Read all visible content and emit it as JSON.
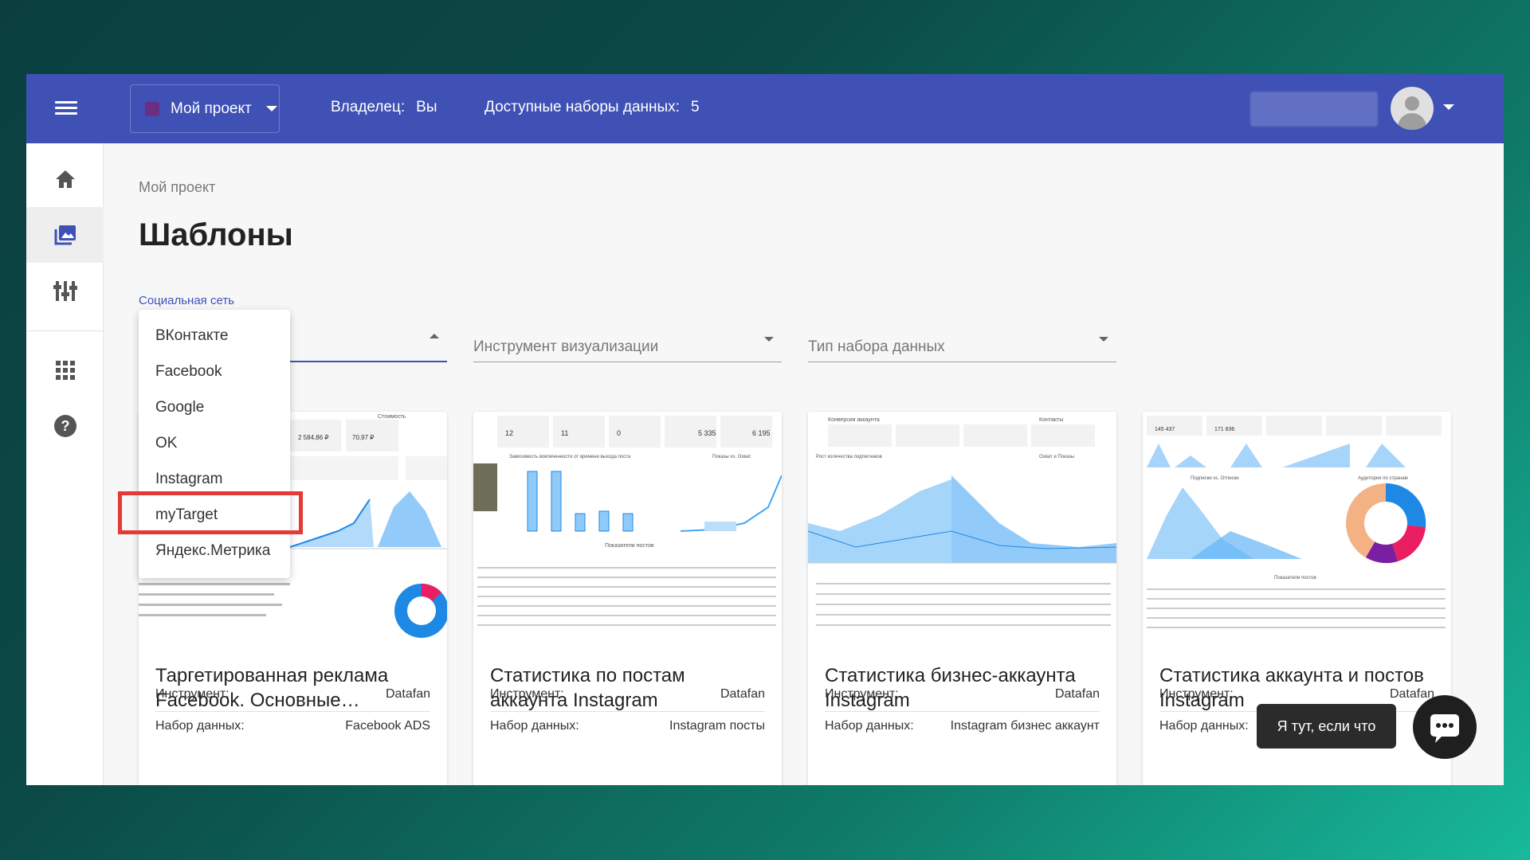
{
  "header": {
    "project_name": "Мой проект",
    "owner_label": "Владелец:",
    "owner_value": "Вы",
    "datasets_label": "Доступные наборы данных:",
    "datasets_count": "5"
  },
  "breadcrumb": "Мой проект",
  "page_title": "Шаблоны",
  "filters": {
    "social_label": "Социальная сеть",
    "viz_placeholder": "Инструмент визуализации",
    "dataset_type_placeholder": "Тип набора данных"
  },
  "social_options": [
    "ВКонтакте",
    "Facebook",
    "Google",
    "OK",
    "Instagram",
    "myTarget",
    "Яндекс.Метрика"
  ],
  "highlighted_option": "myTarget",
  "card_labels": {
    "tool": "Инструмент:",
    "dataset": "Набор данных:"
  },
  "cards": [
    {
      "title": "Таргетированная реклама Facebook. Основные…",
      "tool": "Datafan",
      "dataset": "Facebook ADS"
    },
    {
      "title": "Статистика по постам аккаунта Instagram",
      "tool": "Datafan",
      "dataset": "Instagram посты"
    },
    {
      "title": "Статистика бизнес-аккаунта Instagram",
      "tool": "Datafan",
      "dataset": "Instagram бизнес аккаунт"
    },
    {
      "title": "Статистика аккаунта и постов Instagram",
      "tool": "Datafan",
      "dataset": ""
    }
  ],
  "thumbnail_text": {
    "cost": "Стоимость",
    "cost_value": "2 584,86 ₽",
    "cost_value2": "70,97 ₽",
    "engagement": "Зависимость вовлеченности от времени выхода поста",
    "impressions_reach": "Показы vs. Охват",
    "posts_metrics": "Показатели постов",
    "conversion": "Конверсия аккаунта",
    "contacts": "Контакты",
    "followers_growth": "Рост количества подписчиков",
    "reach_impressions": "Охват и Показы",
    "followers_vs_unfollows": "Подписки vs. Отписки",
    "by_country": "Аудитория по странам",
    "post_metrics": "Показатели постов",
    "kpi1": "12",
    "kpi2": "11",
    "kpi3": "0",
    "kpi4": "5 335",
    "kpi5": "6 195",
    "kpi6": "145 437",
    "kpi7": "171 836"
  },
  "tooltip": "Я тут, если что",
  "icons": {
    "menu": "menu-icon",
    "home": "home-icon",
    "templates": "image-icon",
    "settings": "sliders-icon",
    "apps": "apps-grid-icon",
    "help": "help-icon",
    "chat": "chat-icon"
  },
  "colors": {
    "primary": "#3f51b5",
    "highlight": "#e53935",
    "project_swatch": "#6a2e84"
  }
}
